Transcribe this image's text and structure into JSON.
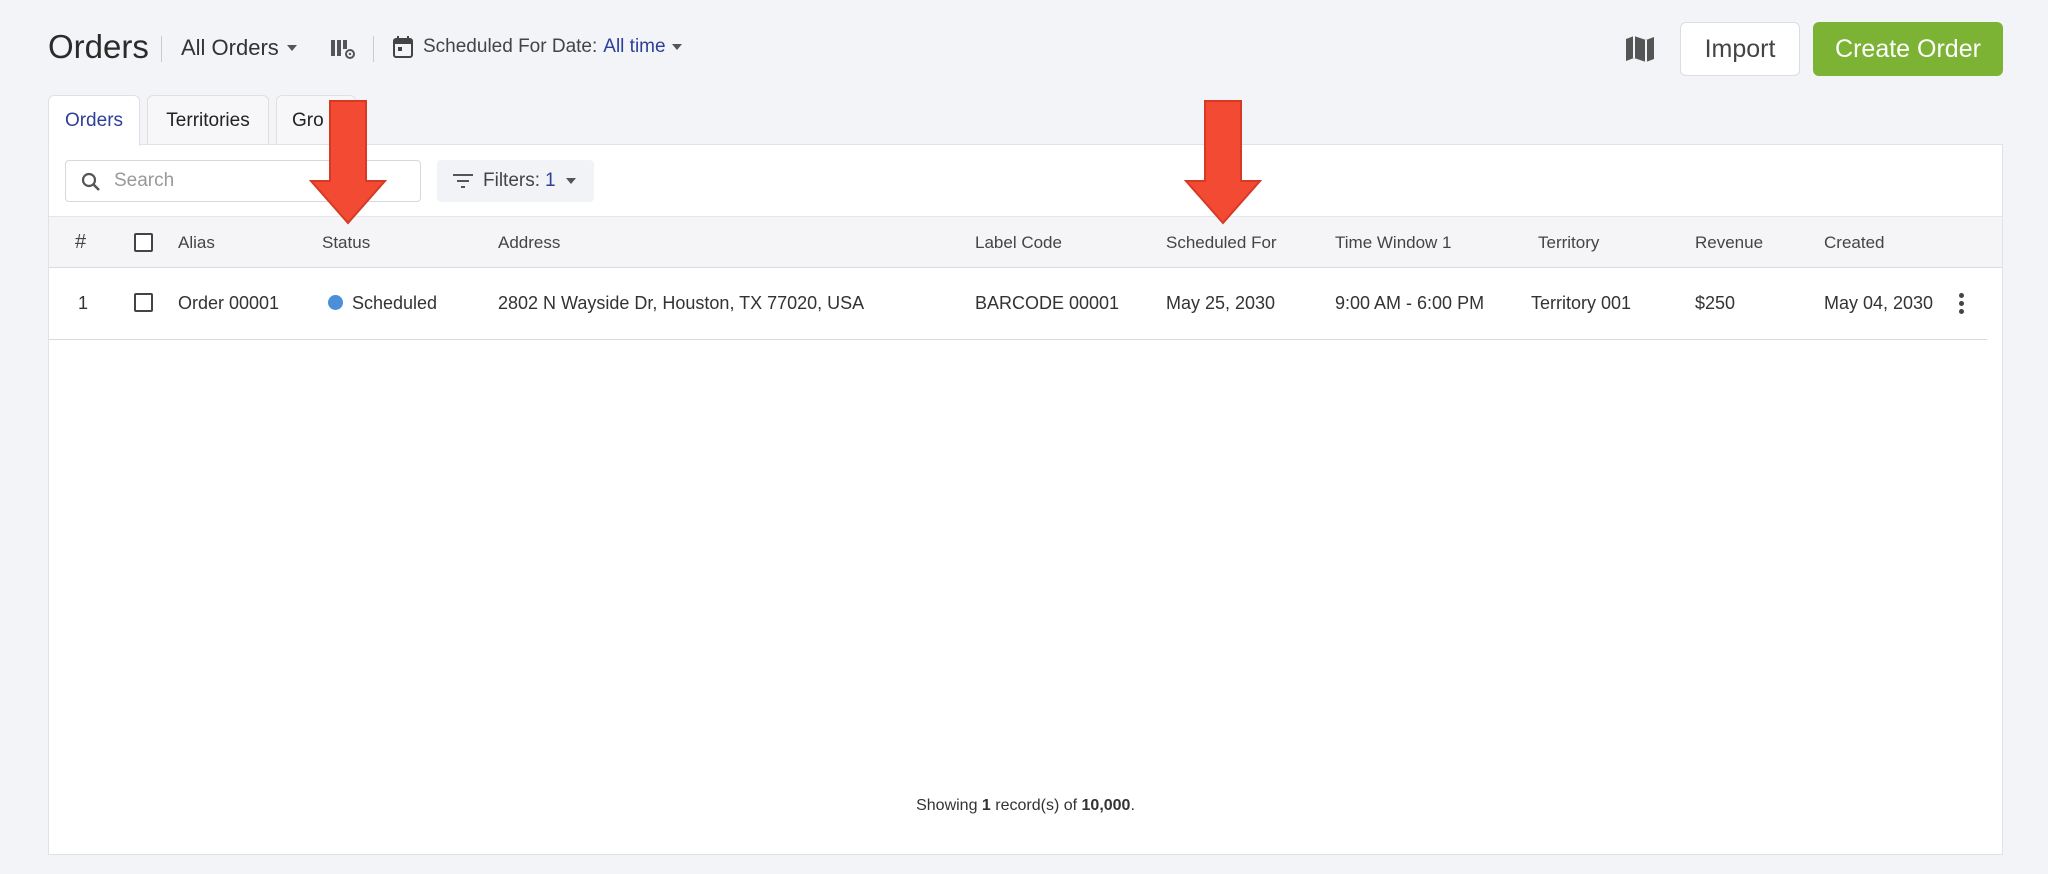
{
  "header": {
    "title": "Orders",
    "view_select": "All Orders",
    "date_filter_label": "Scheduled For Date:",
    "date_filter_value": "All time",
    "import_label": "Import",
    "create_label": "Create Order"
  },
  "tabs": [
    {
      "label": "Orders",
      "active": true
    },
    {
      "label": "Territories",
      "active": false
    },
    {
      "label": "Gro",
      "active": false
    }
  ],
  "toolbar": {
    "search_placeholder": "Search",
    "filters_label": "Filters:",
    "filters_count": "1"
  },
  "table": {
    "columns": [
      "#",
      "Alias",
      "Status",
      "Address",
      "Label Code",
      "Scheduled For",
      "Time Window 1",
      "Territory",
      "Revenue",
      "Created"
    ],
    "rows": [
      {
        "index": "1",
        "alias": "Order 00001",
        "status": "Scheduled",
        "address": "2802 N Wayside Dr, Houston, TX 77020, USA",
        "label_code": "BARCODE 00001",
        "scheduled_for": "May 25, 2030",
        "time_window": "9:00 AM - 6:00 PM",
        "territory": "Territory 001",
        "revenue": "$250",
        "created": "May 04, 2030"
      }
    ]
  },
  "footer": {
    "prefix": "Showing ",
    "shown": "1",
    "middle": " record(s) of ",
    "total": "10,000",
    "suffix": "."
  },
  "colors": {
    "accent": "#2d3f99",
    "create_button": "#7cb335",
    "status_scheduled": "#4a8fd8",
    "annotation_arrow": "#f24a33"
  },
  "icons": [
    "caret-down-icon",
    "columns-settings-icon",
    "calendar-icon",
    "map-icon",
    "search-icon",
    "filter-icon",
    "kebab-menu-icon",
    "annotation-arrow"
  ]
}
